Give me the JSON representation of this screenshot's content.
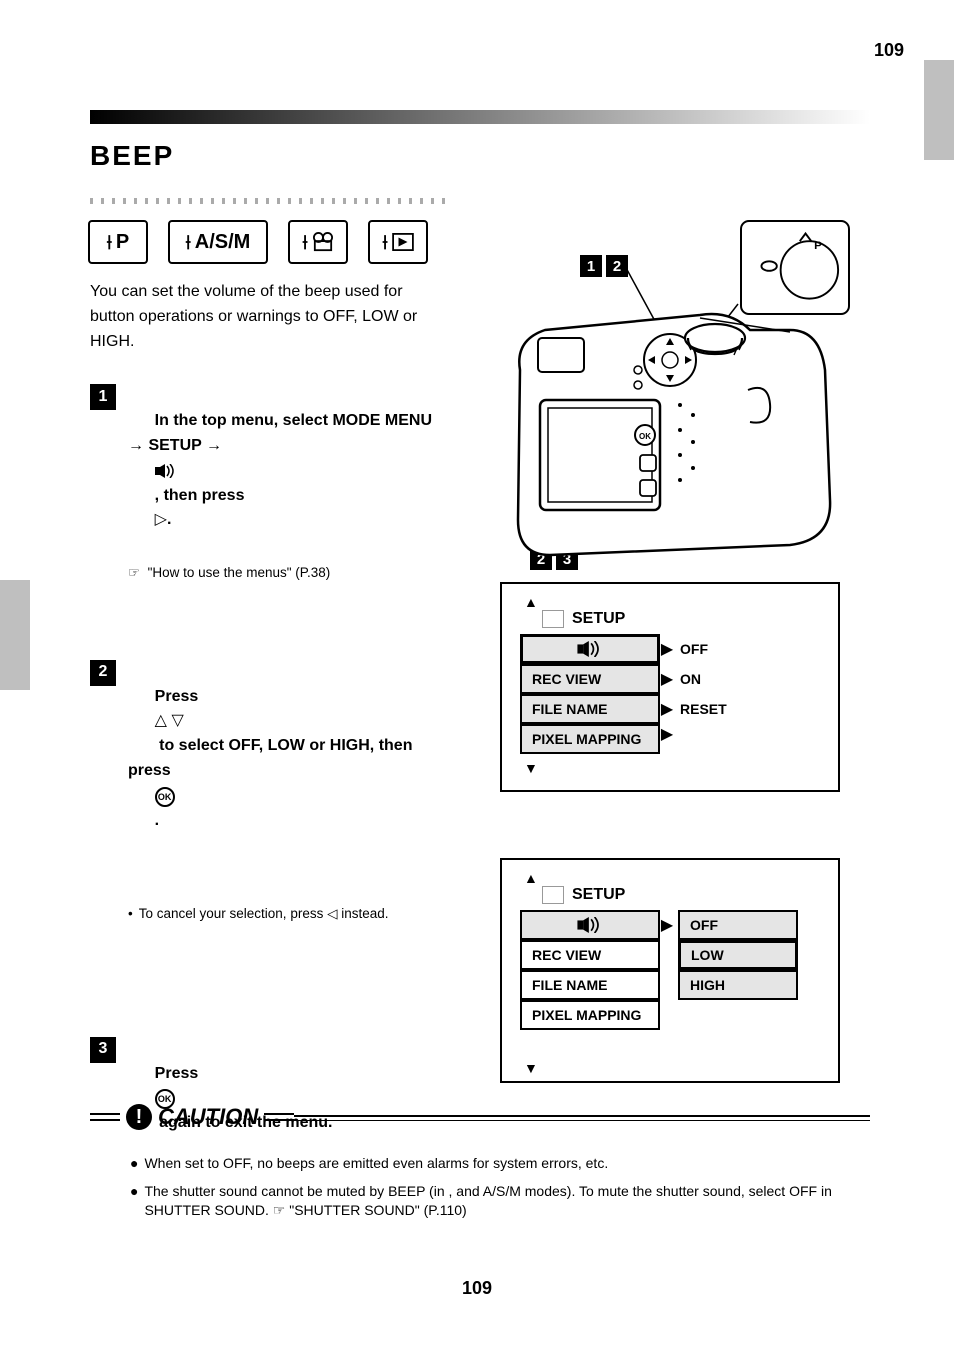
{
  "page_number_top": "109",
  "page_number_bottom": "109",
  "title": "BEEP",
  "dial_labels": [
    "P",
    "A/S/M",
    "",
    ""
  ],
  "step1": {
    "main": "In the top menu, select MODE MENU → SETUP → ",
    "icon_alt": "beep",
    "tail": ", then press ",
    "ref": "  \"How to use the menus\" (P.38)"
  },
  "step2": {
    "main": "Press ",
    "mid": " to select OFF, LOW or HIGH, then press ",
    "end": "."
  },
  "step3": {
    "main": "Press ",
    "tail": " again to exit the menu."
  },
  "callouts": {
    "a": "1",
    "b": "2"
  },
  "menu1": {
    "tab": "SETUP",
    "items": [
      "",
      "REC VIEW",
      "FILE NAME",
      "PIXEL MAPPING"
    ],
    "values": [
      "OFF",
      "ON",
      "RESET"
    ]
  },
  "menu2": {
    "tab": "SETUP",
    "items": [
      "",
      "REC VIEW",
      "FILE NAME",
      "PIXEL MAPPING"
    ],
    "right": [
      "OFF",
      "LOW",
      "HIGH"
    ]
  },
  "caution": {
    "label": "CAUTION",
    "bullets": [
      "When set to OFF, no beeps are emitted even alarms for system errors, etc.",
      "The shutter sound cannot be muted by BEEP (in ,  and A/S/M modes). To mute the shutter sound, select OFF in SHUTTER SOUND. ☞ \"SHUTTER SOUND\" (P.110)"
    ]
  },
  "intro": "You can set the volume of the beep used for button operations or warnings to OFF, LOW or HIGH."
}
